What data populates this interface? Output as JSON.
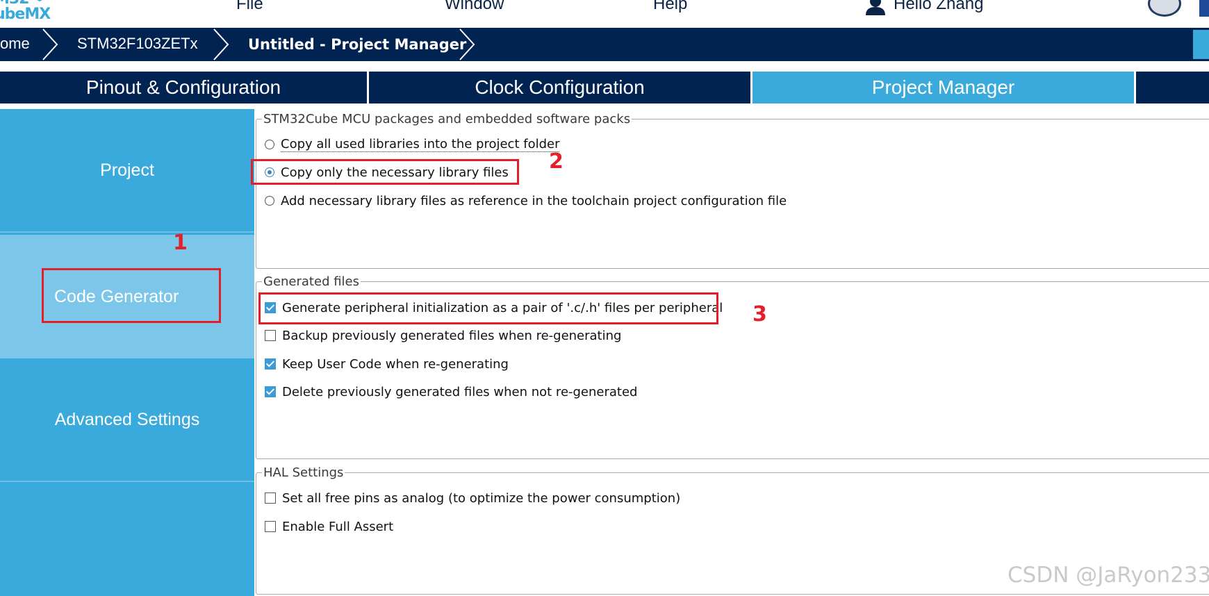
{
  "app": {
    "logo_line1": "M32",
    "logo_line2": "ubeMX"
  },
  "menubar": {
    "items": [
      "File",
      "Window",
      "Help"
    ],
    "user_name": "Hello Zhang"
  },
  "breadcrumb": {
    "items": [
      "ome",
      "STM32F103ZETx",
      "Untitled - Project Manager"
    ]
  },
  "tabs": [
    {
      "label": "Pinout & Configuration",
      "active": false
    },
    {
      "label": "Clock Configuration",
      "active": false
    },
    {
      "label": "Project Manager",
      "active": true
    }
  ],
  "sidebar": {
    "items": [
      {
        "label": "Project",
        "selected": false
      },
      {
        "label": "Code Generator",
        "selected": true
      },
      {
        "label": "Advanced Settings",
        "selected": false
      }
    ]
  },
  "packages_group": {
    "legend": "STM32Cube MCU packages and embedded software packs",
    "options": [
      {
        "label": "Copy all used libraries into the project folder",
        "selected": false
      },
      {
        "label": "Copy only the necessary library files",
        "selected": true
      },
      {
        "label": "Add necessary library files as reference in the toolchain project configuration file",
        "selected": false
      }
    ]
  },
  "generated_group": {
    "legend": "Generated files",
    "options": [
      {
        "label": "Generate peripheral initialization as a pair of '.c/.h' files per peripheral",
        "checked": true
      },
      {
        "label": "Backup previously generated files when re-generating",
        "checked": false
      },
      {
        "label": "Keep User Code when re-generating",
        "checked": true
      },
      {
        "label": "Delete previously generated files when not re-generated",
        "checked": true
      }
    ]
  },
  "hal_group": {
    "legend": "HAL Settings",
    "options": [
      {
        "label": "Set all free pins as analog (to optimize the power consumption)",
        "checked": false
      },
      {
        "label": "Enable Full Assert",
        "checked": false
      }
    ]
  },
  "annotations": {
    "marks": [
      "1",
      "2",
      "3"
    ],
    "color": "#e3202a"
  },
  "watermark": "CSDN @JaRyon233",
  "colors": {
    "navy": "#002352",
    "accent": "#3aaadc",
    "sidebar_selected": "#7cc6ea"
  }
}
